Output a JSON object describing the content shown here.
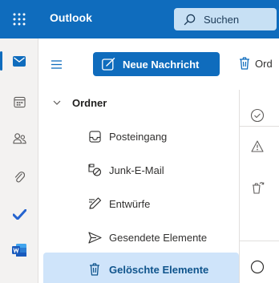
{
  "app": {
    "title": "Outlook"
  },
  "search": {
    "placeholder": "Suchen"
  },
  "toolbar": {
    "new_message": "Neue Nachricht",
    "delete": "Ord"
  },
  "folders": {
    "header": "Ordner",
    "items": [
      {
        "label": "Posteingang",
        "icon": "inbox-icon"
      },
      {
        "label": "Junk-E-Mail",
        "icon": "junk-icon"
      },
      {
        "label": "Entwürfe",
        "icon": "drafts-icon"
      },
      {
        "label": "Gesendete Elemente",
        "icon": "sent-icon"
      },
      {
        "label": "Gelöschte Elemente",
        "icon": "trash-icon",
        "selected": true
      }
    ]
  },
  "rail": [
    "mail-icon",
    "calendar-icon",
    "people-icon",
    "attachment-icon",
    "todo-icon",
    "word-icon"
  ],
  "colors": {
    "brand": "#0f6cbd",
    "selected": "#cfe4fa",
    "search_bg": "#c7e0f4",
    "rail_bg": "#f3f2f1"
  }
}
